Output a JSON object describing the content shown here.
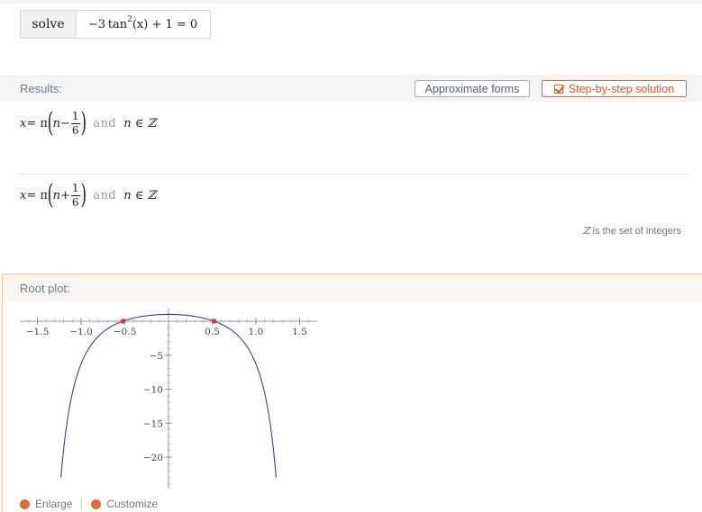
{
  "input": {
    "command": "solve",
    "expr_prefix": "−3 tan",
    "expr_power": "2",
    "expr_suffix": "(x) + 1 = 0"
  },
  "results": {
    "title": "Results:",
    "approx_button": "Approximate forms",
    "step_button": "Step-by-step solution",
    "solutions": [
      {
        "lhs": "x",
        "eq": " = π",
        "n": "n",
        "op": " − ",
        "num": "1",
        "den": "6",
        "and": "and",
        "cond": "n ∈ ℤ"
      },
      {
        "lhs": "x",
        "eq": " = π",
        "n": "n",
        "op": " + ",
        "num": "1",
        "den": "6",
        "and": "and",
        "cond": "n ∈ ℤ"
      }
    ],
    "note_symbol": "ℤ",
    "note_text": " is the set of integers"
  },
  "plot": {
    "title": "Root plot:",
    "footer": {
      "enlarge": "Enlarge",
      "customize": "Customize"
    }
  },
  "chart_data": {
    "type": "line",
    "function": "-3 tan^2(x) + 1",
    "xlim": [
      -1.5,
      1.5
    ],
    "ylim": [
      -23,
      1
    ],
    "x_ticks": [
      -1.5,
      -1.0,
      -0.5,
      0.5,
      1.0,
      1.5
    ],
    "x_tick_labels": [
      "−1.5",
      "−1.0",
      "−0.5",
      "0.5",
      "1.0",
      "1.5"
    ],
    "y_ticks": [
      -5,
      -10,
      -15,
      -20
    ],
    "y_tick_labels": [
      "−5",
      "−10",
      "−15",
      "−20"
    ],
    "roots": [
      [
        -0.5236,
        0
      ],
      [
        0.5236,
        0
      ]
    ],
    "series_color": "#3d3d9e",
    "root_color": "#e53030"
  }
}
